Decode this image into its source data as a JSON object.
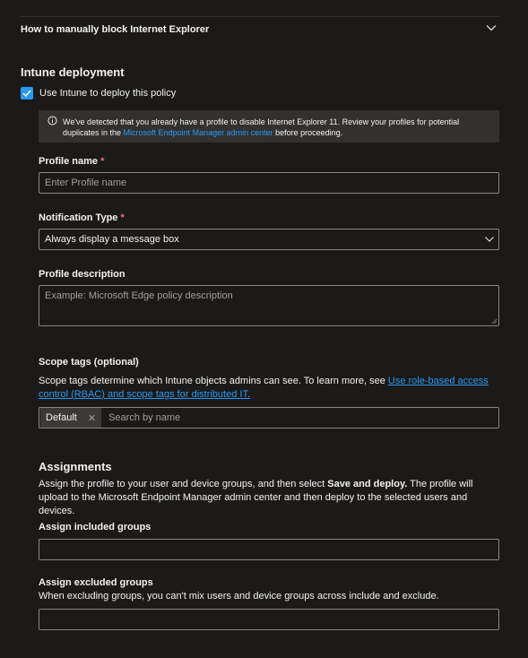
{
  "accordion": {
    "title": "How to manually block Internet Explorer"
  },
  "intune": {
    "section_title": "Intune deployment",
    "checkbox_label": "Use Intune to deploy this policy",
    "checkbox_checked": true,
    "info_text_before": "We've detected that you already have a profile to disable Internet Explorer 11. Review your profiles for potential duplicates in the ",
    "info_link": "Microsoft Endpoint Manager admin center",
    "info_text_after": " before proceeding."
  },
  "profile_name": {
    "label": "Profile name",
    "required_mark": "*",
    "placeholder": "Enter Profile name"
  },
  "notification_type": {
    "label": "Notification Type",
    "required_mark": "*",
    "selected": "Always display a message box"
  },
  "profile_description": {
    "label": "Profile description",
    "placeholder": "Example: Microsoft Edge policy description"
  },
  "scope_tags": {
    "label": "Scope tags (optional)",
    "desc_before": "Scope tags determine which Intune objects admins can see. To learn more, see ",
    "desc_link": "Use role-based access control (RBAC) and scope tags for distributed IT.",
    "tag": "Default",
    "remove_glyph": "✕",
    "search_placeholder": "Search by name"
  },
  "assignments": {
    "section_title": "Assignments",
    "desc_before": "Assign the profile to your user and device groups, and then select ",
    "desc_bold": "Save and deploy.",
    "desc_after": " The profile will upload to the Microsoft Endpoint Manager admin center and then deploy to the selected users and devices.",
    "included_label": "Assign included groups",
    "excluded_label": "Assign excluded groups",
    "excluded_desc": "When excluding groups, you can't mix users and device groups across include and exclude."
  },
  "colors": {
    "background": "#1b1a19",
    "accent": "#2899f5",
    "required": "#f1707b",
    "info_box": "#323130"
  }
}
